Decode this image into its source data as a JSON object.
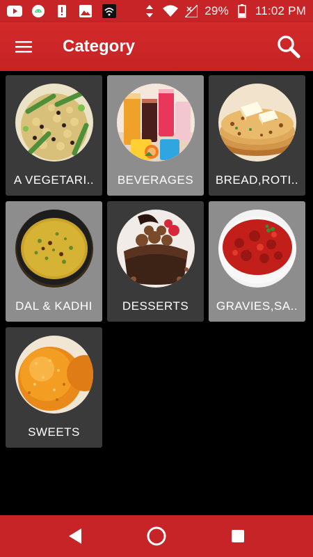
{
  "status_bar": {
    "battery": "29%",
    "time": "11:02 PM",
    "icons": [
      "youtube-icon",
      "android-icon",
      "alert-icon",
      "image-icon",
      "signal-box-icon",
      "data-arrows-icon",
      "wifi-icon",
      "cell-signal-icon",
      "battery-icon"
    ]
  },
  "app_bar": {
    "title": "Category",
    "menu_icon": "hamburger-menu-icon",
    "search_icon": "search-icon"
  },
  "categories": [
    {
      "label": "A VEGETARI..",
      "image": "salad-bowl-image"
    },
    {
      "label": "BEVERAGES",
      "image": "drinks-glasses-image"
    },
    {
      "label": "BREAD,ROTI..",
      "image": "paratha-butter-image"
    },
    {
      "label": "DAL & KADHI",
      "image": "dal-bowl-image"
    },
    {
      "label": "DESSERTS",
      "image": "chocolate-dessert-image"
    },
    {
      "label": "GRAVIES,SA..",
      "image": "red-gravy-image"
    },
    {
      "label": "SWEETS",
      "image": "laddoo-image"
    }
  ],
  "nav_bar": {
    "icons": [
      "back-icon",
      "home-icon",
      "recents-icon"
    ]
  },
  "colors": {
    "primary": "#c62426",
    "card_dark": "#3a3a3a",
    "card_light": "#8d8d8d",
    "background": "#000000"
  }
}
